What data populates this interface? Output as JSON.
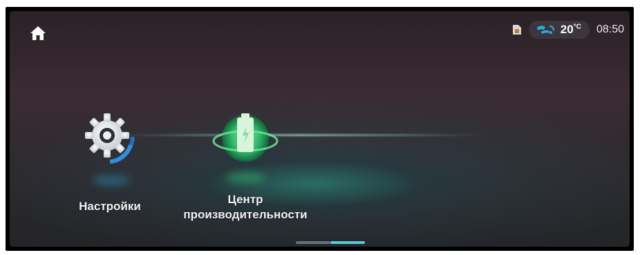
{
  "status_bar": {
    "temperature": "20",
    "temperature_unit": "°C",
    "time": "08:50"
  },
  "apps": [
    {
      "id": "settings",
      "label_lines": [
        "Настройки"
      ]
    },
    {
      "id": "performance",
      "label_lines": [
        "Центр",
        "производительности"
      ]
    }
  ],
  "pager": {
    "pages": 2,
    "active": 1
  },
  "colors": {
    "accent_green": "#33d07a",
    "accent_blue": "#2a8ad6",
    "pager_active": "#5fc8d8",
    "pager_inactive": "#6a6f78"
  },
  "icons": {
    "home": "home-icon",
    "sim": "sim-card-icon",
    "climate": "climate-fan-icon",
    "settings": "gear-icon",
    "performance": "battery-globe-icon"
  }
}
